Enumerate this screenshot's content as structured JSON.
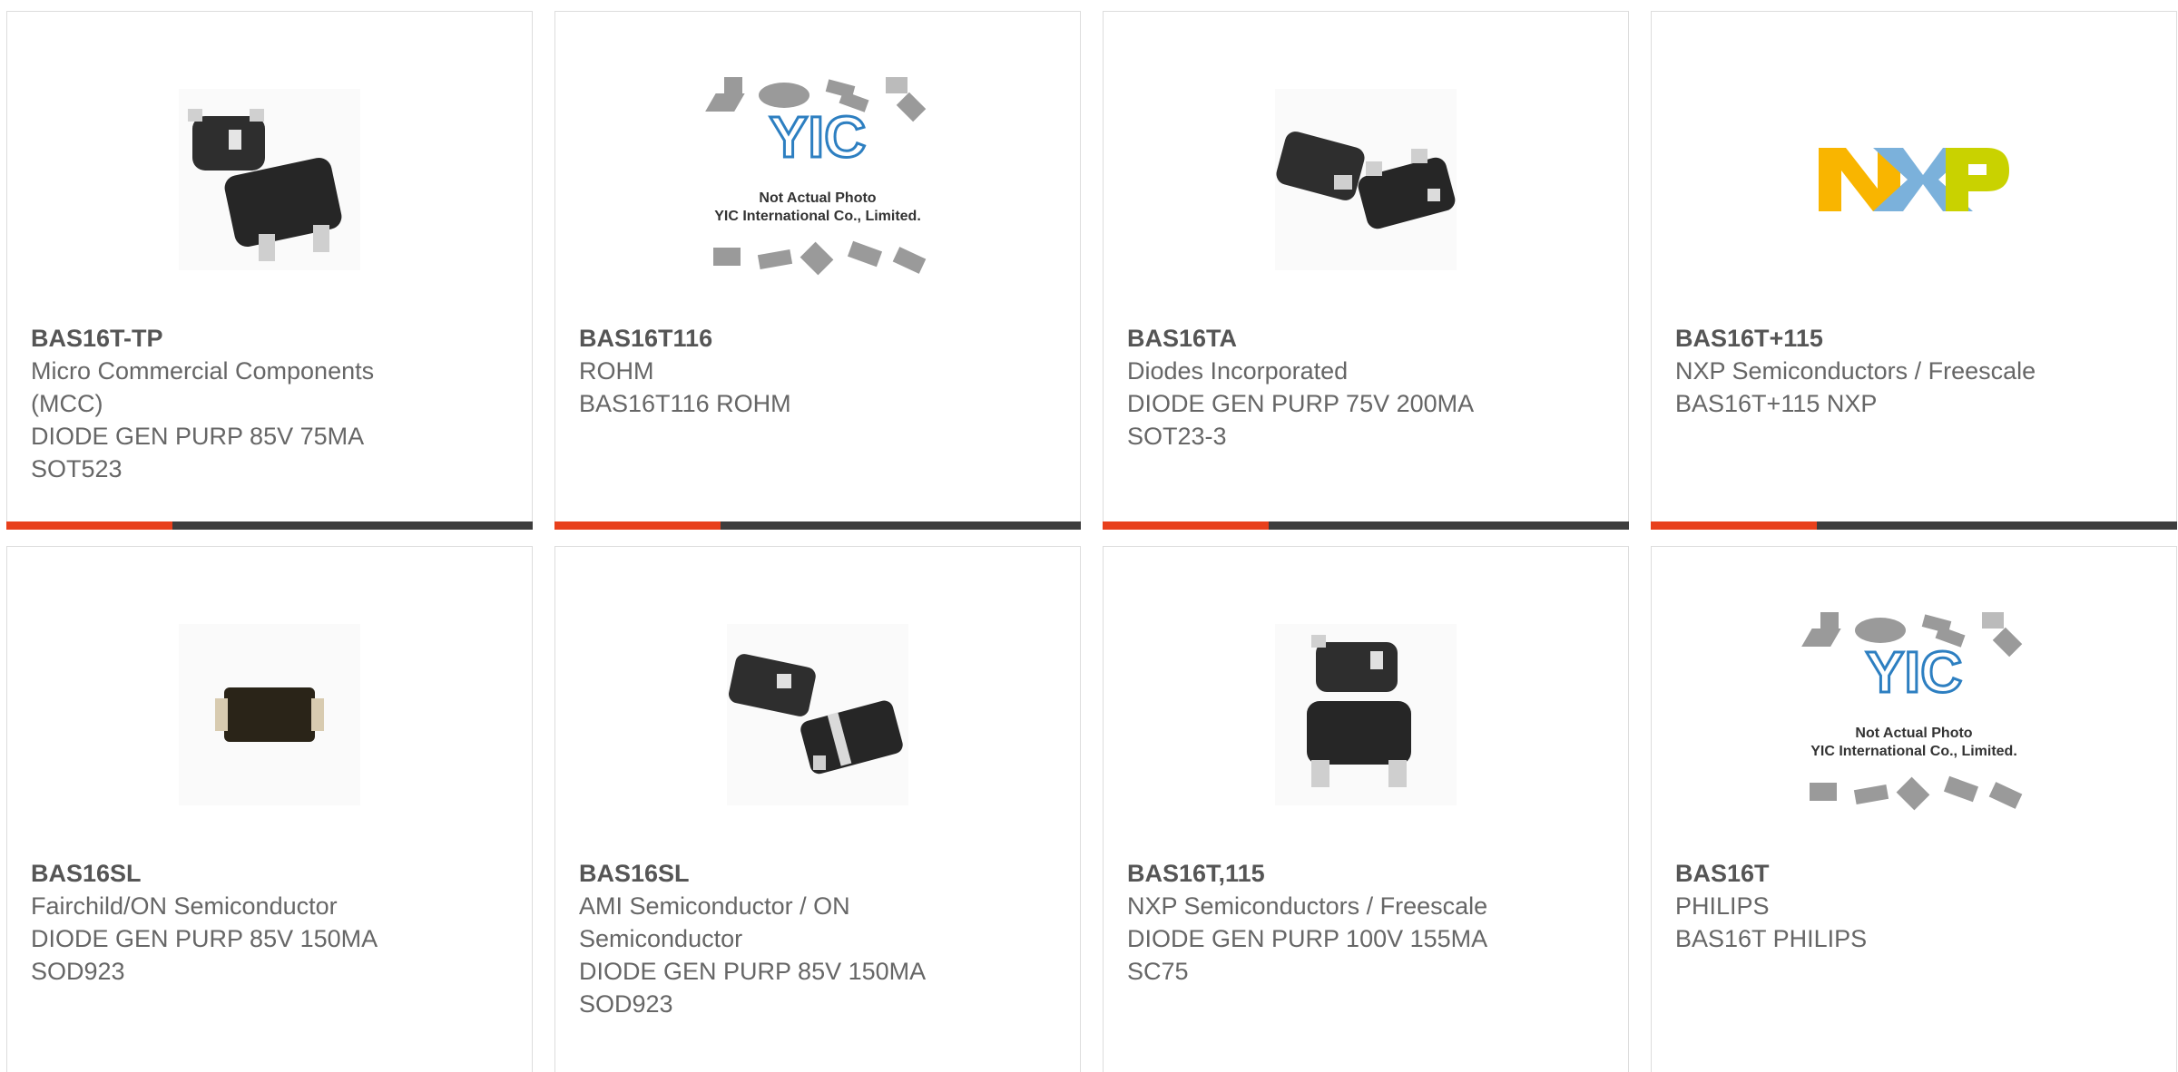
{
  "parts": [
    {
      "pn": "BAS16T-TP",
      "lines": [
        "Micro Commercial Components",
        "(MCC)",
        "DIODE GEN PURP 85V 75MA",
        "SOT523"
      ],
      "image": "sot523-photo"
    },
    {
      "pn": "BAS16T116",
      "lines": [
        "ROHM",
        "BAS16T116 ROHM"
      ],
      "image": "placeholder-photo"
    },
    {
      "pn": "BAS16TA",
      "lines": [
        "Diodes Incorporated",
        "DIODE GEN PURP 75V 200MA",
        "SOT23-3"
      ],
      "image": "sot23-photo"
    },
    {
      "pn": "BAS16T+115",
      "lines": [
        "NXP Semiconductors / Freescale",
        "BAS16T+115 NXP"
      ],
      "image": "nxp-logo"
    },
    {
      "pn": "BAS16SL",
      "lines": [
        "Fairchild/ON Semiconductor",
        "DIODE GEN PURP 85V 150MA",
        "SOD923"
      ],
      "image": "sod923-photo"
    },
    {
      "pn": "BAS16SL",
      "lines": [
        "AMI Semiconductor / ON",
        "Semiconductor",
        "DIODE GEN PURP 85V 150MA",
        "SOD923"
      ],
      "image": "sod-photo"
    },
    {
      "pn": "BAS16T,115",
      "lines": [
        "NXP Semiconductors / Freescale",
        "DIODE GEN PURP 100V 155MA",
        "SC75"
      ],
      "image": "sc75-photo"
    },
    {
      "pn": "BAS16T",
      "lines": [
        "PHILIPS",
        "BAS16T PHILIPS"
      ],
      "image": "placeholder-photo"
    }
  ],
  "placeholder": {
    "logo_text": "YIC",
    "line1": "Not Actual Photo",
    "line2": "YIC International Co., Limited."
  },
  "nxp_logo": {
    "text": "NXP",
    "colors": [
      "#f9b500",
      "#7bb1db",
      "#c9d200"
    ]
  },
  "colors": {
    "accent": "#e8401c",
    "bar": "#3d3d3d",
    "text": "#666666",
    "border": "#dddddd"
  }
}
